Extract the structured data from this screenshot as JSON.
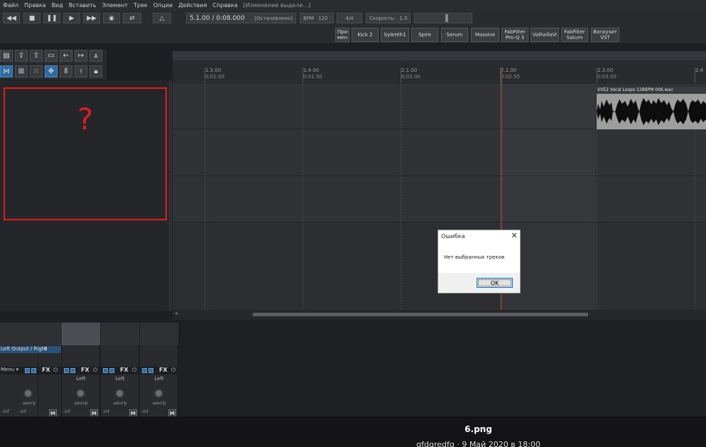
{
  "menu": {
    "items": [
      "Файл",
      "Правка",
      "Вид",
      "Вставить",
      "Элемент",
      "Трек",
      "Опции",
      "Действия",
      "Справка"
    ],
    "status": "[Изменение выделе...]"
  },
  "transport": {
    "time": "5.1.00 / 0:08.000",
    "state": "[Остановлено]",
    "bpm_label": "BPM",
    "bpm": "120",
    "timesig": "4/4",
    "rate_label": "Скорость:",
    "rate": "1.0"
  },
  "plugins": [
    "При\nмен",
    "Kick 2",
    "Sylenth1",
    "Spire",
    "Serum",
    "Massive",
    "FabFilter\nPro-Q 3",
    "ValhallaVi",
    "FabFilter\nSaturn",
    "Вогрузит\nVST"
  ],
  "ruler": {
    "marks": [
      {
        "bar": "1.3.00",
        "time": "0:01.00"
      },
      {
        "bar": "1.4.00",
        "time": "0:01.50"
      },
      {
        "bar": "2.1.00",
        "time": "0:02.00"
      },
      {
        "bar": "2.2.00",
        "time": "0:02.50"
      },
      {
        "bar": "2.3.00",
        "time": "0:03.00"
      },
      {
        "bar": "2.4",
        "time": ""
      }
    ]
  },
  "clip": {
    "title": "VVE2 Vocal Loops 128BPM 006.wav"
  },
  "annotation": {
    "symbol": "?",
    "color": "#e01d1d"
  },
  "dialog": {
    "title": "Ошибка",
    "message": "Нет выбранных треков",
    "ok": "OK",
    "close": "✕"
  },
  "mixer": {
    "output": "Left Output / Right",
    "output_val": "0",
    "menu": "Menu ▾",
    "fx": "FX",
    "left": "Left",
    "center": "центр",
    "inf": "-inf",
    "m": "M",
    "s": "S"
  },
  "caption": {
    "file": "6.png",
    "sub": "gfdgredfg · 9 Май 2020 в 18:00"
  },
  "colors": {
    "accent": "#2f6aa0",
    "annotation": "#e01d1d"
  }
}
